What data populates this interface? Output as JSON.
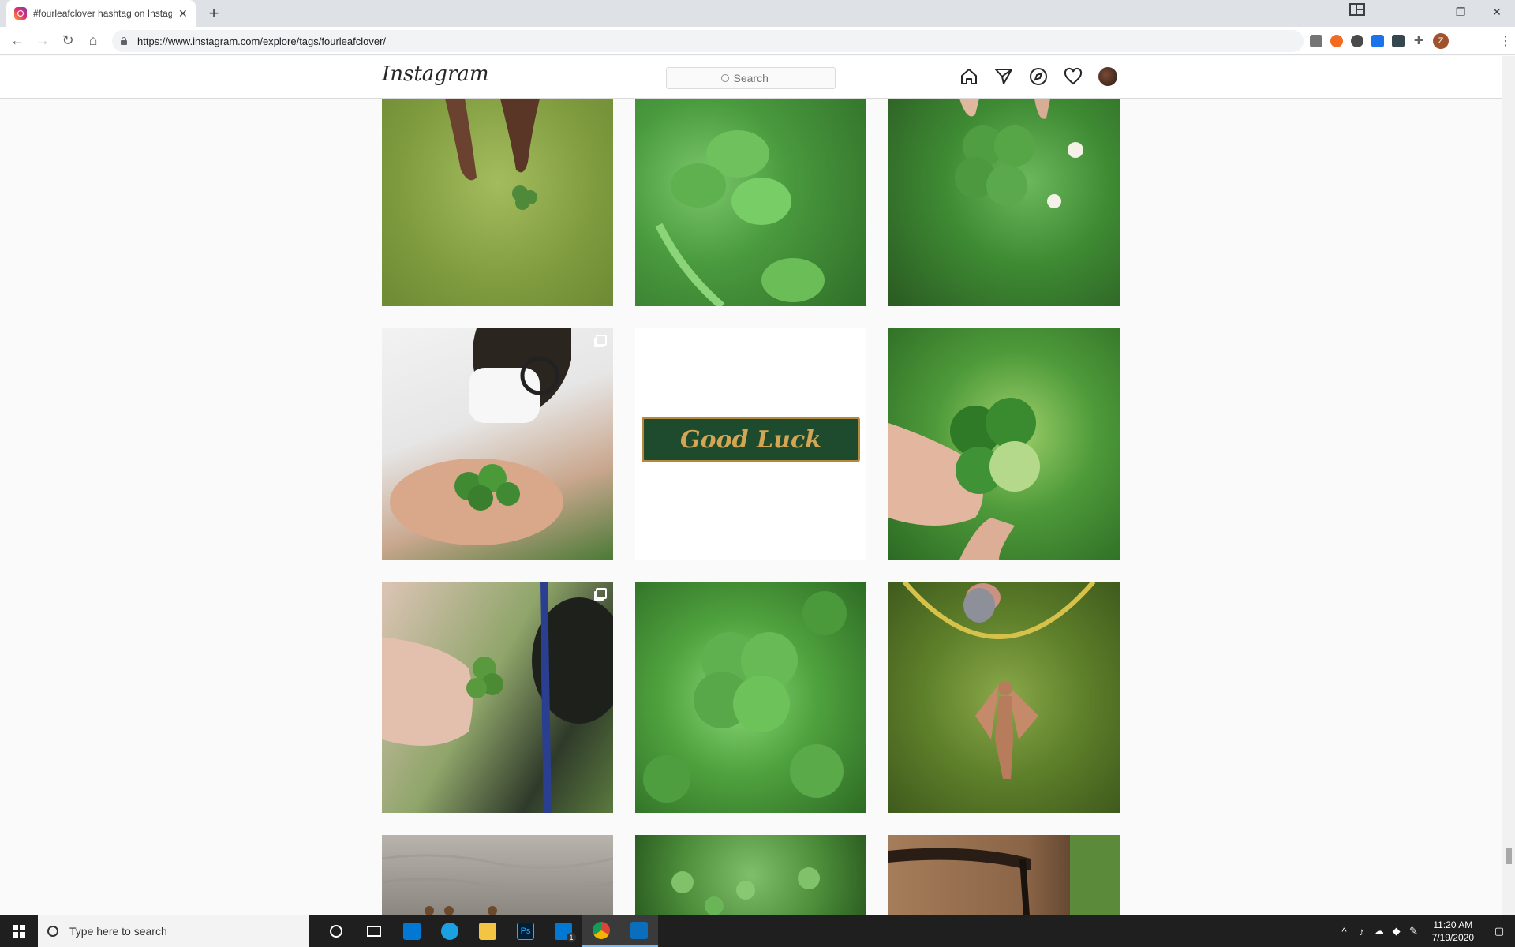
{
  "browser": {
    "tab_title": "#fourleafclover hashtag on Instagram",
    "url": "https://www.instagram.com/explore/tags/fourleafclover/",
    "profile_initial": "Z"
  },
  "instagram": {
    "logo": "Instagram",
    "search_placeholder": "Search"
  },
  "posts": [
    {
      "desc": "hand holding clover over grass",
      "multi": false
    },
    {
      "desc": "clover leaves close-up",
      "multi": false
    },
    {
      "desc": "four leaf clover held among white clover flowers",
      "multi": false
    },
    {
      "desc": "person in mask holding clovers",
      "multi": true
    },
    {
      "desc": "Good Luck horseshoe pin",
      "multi": false,
      "text": "Good Luck"
    },
    {
      "desc": "hand holding four leaf clover",
      "multi": false
    },
    {
      "desc": "hand holding clover with dog in background",
      "multi": true
    },
    {
      "desc": "patch of four leaf clovers",
      "multi": false
    },
    {
      "desc": "fairy pendant on moss",
      "multi": false
    },
    {
      "desc": "water scene",
      "multi": false
    },
    {
      "desc": "grass with clovers",
      "multi": false
    },
    {
      "desc": "horse bridle",
      "multi": false
    }
  ],
  "taskbar": {
    "search_placeholder": "Type here to search",
    "time": "11:20 AM",
    "date": "7/19/2020",
    "mail_badge": "1"
  }
}
